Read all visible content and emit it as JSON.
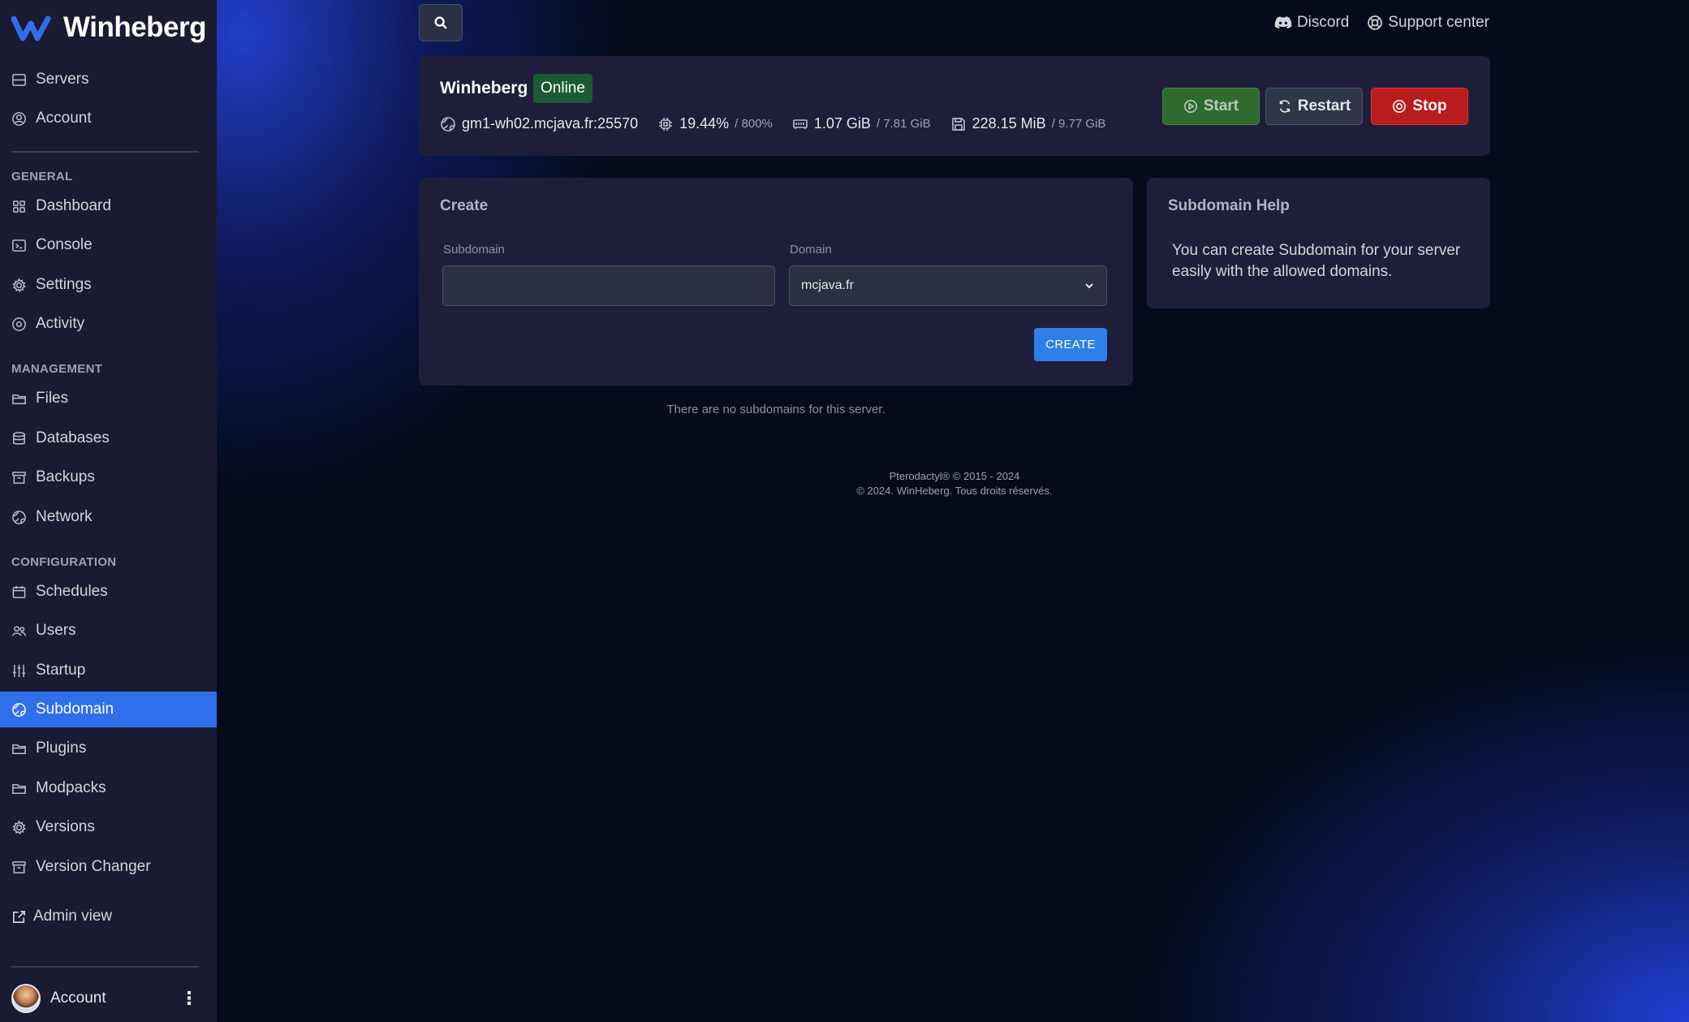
{
  "brand": {
    "name": "Winheberg"
  },
  "sidebar": {
    "top_items": [
      {
        "label": "Servers",
        "icon": "server-icon"
      },
      {
        "label": "Account",
        "icon": "user-circle-icon"
      }
    ],
    "sections": [
      {
        "title": "GENERAL",
        "items": [
          {
            "label": "Dashboard",
            "icon": "grid-icon"
          },
          {
            "label": "Console",
            "icon": "terminal-icon"
          },
          {
            "label": "Settings",
            "icon": "gear-icon"
          },
          {
            "label": "Activity",
            "icon": "eye-icon"
          }
        ]
      },
      {
        "title": "MANAGEMENT",
        "items": [
          {
            "label": "Files",
            "icon": "folder-icon"
          },
          {
            "label": "Databases",
            "icon": "database-icon"
          },
          {
            "label": "Backups",
            "icon": "archive-icon"
          },
          {
            "label": "Network",
            "icon": "globe-icon"
          }
        ]
      },
      {
        "title": "CONFIGURATION",
        "items": [
          {
            "label": "Schedules",
            "icon": "calendar-icon"
          },
          {
            "label": "Users",
            "icon": "users-icon"
          },
          {
            "label": "Startup",
            "icon": "sliders-icon"
          },
          {
            "label": "Subdomain",
            "icon": "globe-icon",
            "active": true
          },
          {
            "label": "Plugins",
            "icon": "folder-icon"
          },
          {
            "label": "Modpacks",
            "icon": "folder-icon"
          },
          {
            "label": "Versions",
            "icon": "gear-icon"
          },
          {
            "label": "Version Changer",
            "icon": "archive-icon"
          }
        ]
      }
    ],
    "admin_view": "Admin view",
    "footer_account": "Account"
  },
  "topbar": {
    "discord": "Discord",
    "support": "Support center"
  },
  "server": {
    "name": "Winheberg",
    "status": "Online",
    "address": "gm1-wh02.mcjava.fr:25570",
    "cpu": "19.44%",
    "cpu_limit": "/ 800%",
    "memory": "1.07 GiB",
    "memory_limit": "/ 7.81 GiB",
    "disk": "228.15 MiB",
    "disk_limit": "/ 9.77 GiB",
    "buttons": {
      "start": "Start",
      "restart": "Restart",
      "stop": "Stop"
    }
  },
  "create": {
    "title": "Create",
    "subdomain_label": "Subdomain",
    "subdomain_value": "",
    "domain_label": "Domain",
    "domain_value": "mcjava.fr",
    "button": "CREATE"
  },
  "help": {
    "title": "Subdomain Help",
    "text": "You can create Subdomain for your server easily with the allowed domains."
  },
  "empty_message": "There are no subdomains for this server.",
  "footer": {
    "line1": "Pterodactyl® © 2015 - 2024",
    "line2": "© 2024. WinHeberg. Tous droits réservés."
  },
  "colors": {
    "accent": "#2f6fec",
    "sidebar_bg": "#1b1a33",
    "panel_bg": "#1f1e3a",
    "online": "#1c5a33",
    "stop": "#b91c1c",
    "start": "#2f6b2f"
  }
}
